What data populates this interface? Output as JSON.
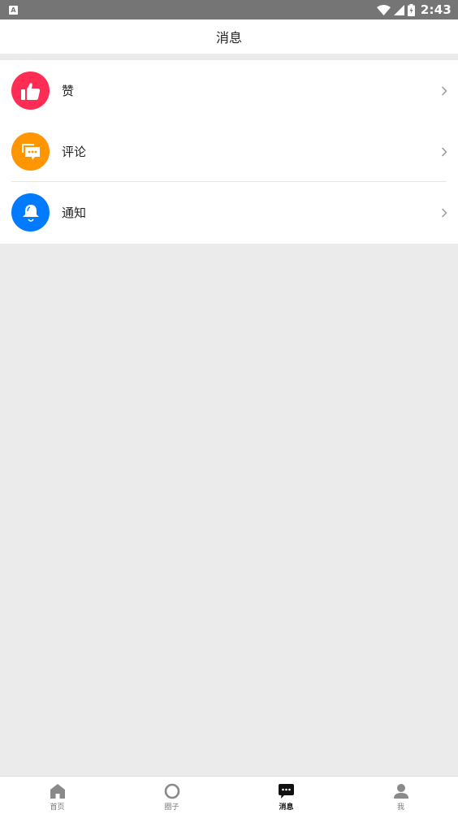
{
  "status_bar": {
    "notification_letter": "A",
    "time": "2:43"
  },
  "header": {
    "title": "消息"
  },
  "messages": {
    "items": [
      {
        "label": "赞",
        "icon": "thumbs-up-icon",
        "color": "#ff2d55"
      },
      {
        "label": "评论",
        "icon": "comment-icon",
        "color": "#ff9500"
      },
      {
        "label": "通知",
        "icon": "bell-icon",
        "color": "#007aff"
      }
    ]
  },
  "bottom_nav": {
    "items": [
      {
        "label": "首页",
        "icon": "home-icon"
      },
      {
        "label": "圈子",
        "icon": "circle-icon"
      },
      {
        "label": "消息",
        "icon": "message-icon",
        "active": true
      },
      {
        "label": "我",
        "icon": "person-icon"
      }
    ]
  }
}
